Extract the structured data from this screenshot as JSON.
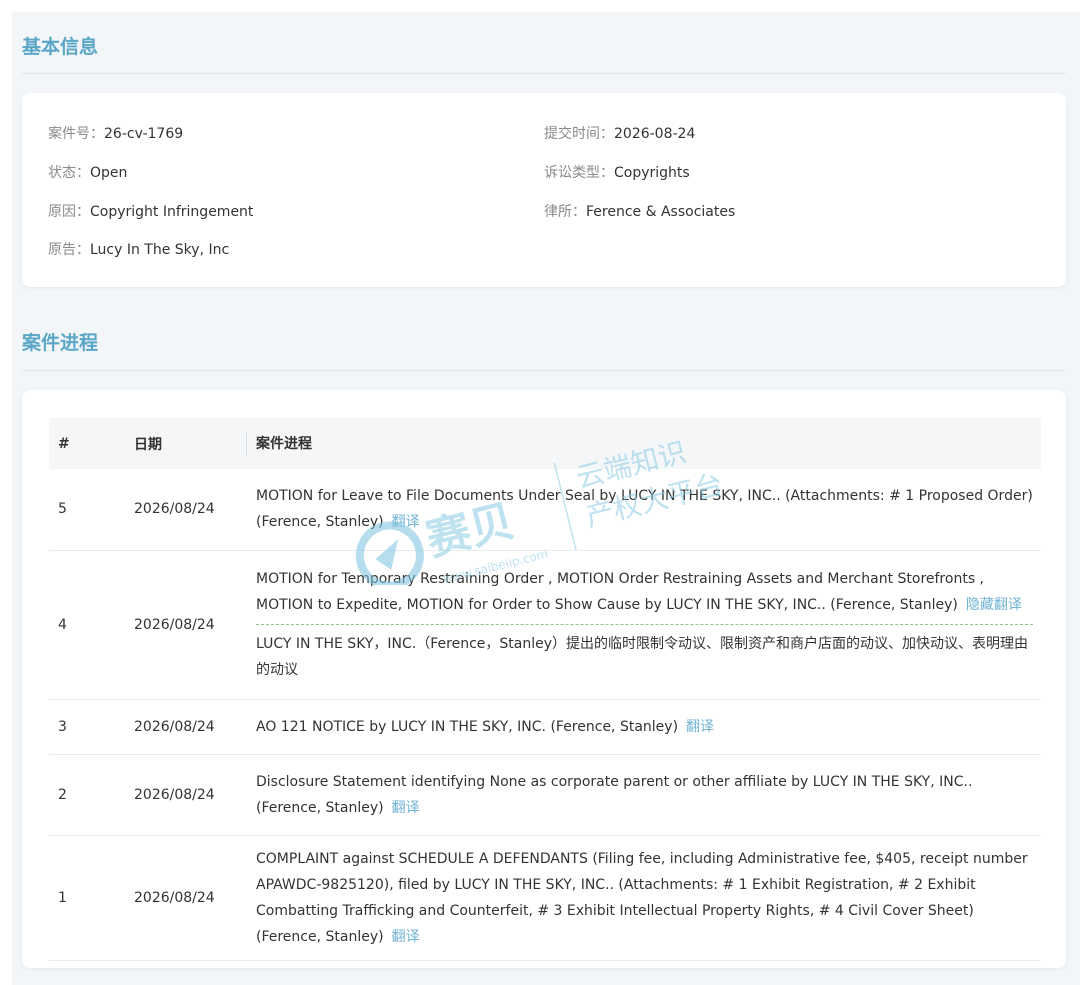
{
  "basic_info": {
    "section_title": "基本信息",
    "case_no_label": "案件号：",
    "case_no": "26-cv-1769",
    "status_label": "状态：",
    "status": "Open",
    "cause_label": "原因：",
    "cause": "Copyright Infringement",
    "plaintiff_label": "原告：",
    "plaintiff": "Lucy In The Sky, Inc",
    "filed_label": "提交时间：",
    "filed": "2026-08-24",
    "type_label": "诉讼类型：",
    "type": "Copyrights",
    "firm_label": "律所：",
    "firm": "Ference & Associates"
  },
  "progress": {
    "section_title": "案件进程",
    "columns": [
      "#",
      "日期",
      "案件进程"
    ],
    "rows": [
      {
        "no": "5",
        "date": "2026/08/24",
        "text": "MOTION for Leave to File Documents Under Seal by LUCY IN THE SKY, INC.. (Attachments: # 1 Proposed Order) (Ference, Stanley)",
        "link": "翻译"
      },
      {
        "no": "4",
        "date": "2026/08/24",
        "text": "MOTION for Temporary Restraining Order , MOTION Order Restraining Assets and Merchant Storefronts , MOTION to Expedite, MOTION for Order to Show Cause by LUCY IN THE SKY, INC.. (Ference, Stanley)",
        "link": "隐藏翻译",
        "translation": "LUCY IN THE SKY，INC.（Ference，Stanley）提出的临时限制令动议、限制资产和商户店面的动议、加快动议、表明理由的动议"
      },
      {
        "no": "3",
        "date": "2026/08/24",
        "text": "AO 121 NOTICE by LUCY IN THE SKY, INC. (Ference, Stanley)",
        "link": "翻译"
      },
      {
        "no": "2",
        "date": "2026/08/24",
        "text": "Disclosure Statement identifying None as corporate parent or other affiliate by LUCY IN THE SKY, INC.. (Ference, Stanley)",
        "link": "翻译"
      },
      {
        "no": "1",
        "date": "2026/08/24",
        "text": "COMPLAINT against SCHEDULE A DEFENDANTS (Filing fee, including Administrative fee, $405, receipt number APAWDC-9825120), filed by LUCY IN THE SKY, INC.. (Attachments: # 1 Exhibit Registration, # 2 Exhibit Combatting Trafficking and Counterfeit, # 3 Exhibit Intellectual Property Rights, # 4 Civil Cover Sheet) (Ference, Stanley)",
        "link": "翻译"
      }
    ]
  },
  "watermark": {
    "brand": "赛贝",
    "tagline_1": "云端知识",
    "tagline_2": "产权大平台",
    "url": "www.saibeiip.com"
  },
  "colors": {
    "accent": "#5aa6c6",
    "link": "#6fb3d2",
    "page_bg": "#f3f6f9",
    "card_bg": "#ffffff",
    "header_bg": "#f4f6f8",
    "dashed_divider": "#8cc68c"
  }
}
